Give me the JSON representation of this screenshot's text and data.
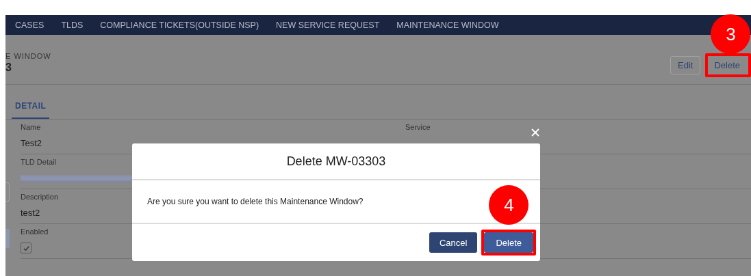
{
  "nav": {
    "tabs": [
      {
        "label": "CASES"
      },
      {
        "label": "TLDS"
      },
      {
        "label": "COMPLIANCE TICKETS(OUTSIDE NSP)"
      },
      {
        "label": "NEW SERVICE REQUEST"
      },
      {
        "label": "MAINTENANCE WINDOW"
      }
    ]
  },
  "header": {
    "object_type": "E WINDOW",
    "record_name": "3",
    "buttons": [
      {
        "label": "Edit",
        "highlighted": false
      },
      {
        "label": "Delete",
        "highlighted": true,
        "step": "3"
      }
    ]
  },
  "detail_tab": {
    "label": "DETAIL",
    "selected": true
  },
  "fields": [
    {
      "label": "Name",
      "kind": "text",
      "value": "Test2"
    },
    {
      "label": "TLD Detail",
      "kind": "redacted_link"
    },
    {
      "label": "Description",
      "kind": "text",
      "value": "test2"
    },
    {
      "label": "Enabled",
      "kind": "checkbox",
      "checked": true
    }
  ],
  "right_fields": [
    {
      "label": "Service"
    }
  ],
  "modal": {
    "title": "Delete MW-03303",
    "message": "Are you sure you want to delete this Maintenance Window?",
    "buttons": [
      {
        "label": "Cancel",
        "kind": "neutral",
        "highlighted": false
      },
      {
        "label": "Delete",
        "kind": "brand",
        "highlighted": true,
        "step": "4"
      }
    ]
  }
}
